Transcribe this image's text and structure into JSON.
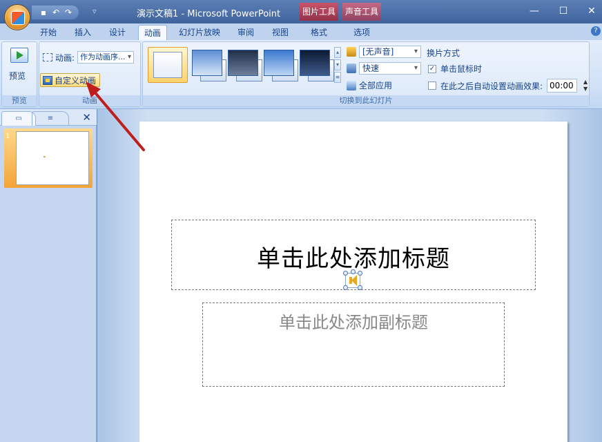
{
  "window": {
    "title": "演示文稿1 - Microsoft PowerPoint",
    "context_tabs": [
      "图片工具",
      "声音工具"
    ],
    "controls": [
      "—",
      "☐",
      "✕"
    ]
  },
  "qat": {
    "icons": [
      "save-icon",
      "undo-icon",
      "redo-icon"
    ]
  },
  "tabs": [
    "开始",
    "插入",
    "设计",
    "动画",
    "幻灯片放映",
    "审阅",
    "视图",
    "格式",
    "选项"
  ],
  "active_tab": "动画",
  "ribbon": {
    "preview": {
      "button_label": "预览",
      "group_label": "预览"
    },
    "animation": {
      "label": "动画:",
      "select_value": "作为动画序...",
      "custom_button": "自定义动画",
      "group_label": "动画"
    },
    "transition": {
      "sound_value": "[无声音]",
      "speed_value": "快速",
      "apply_all": "全部应用",
      "group_label": "切换到此幻灯片"
    },
    "advance": {
      "title": "换片方式",
      "on_click": "单击鼠标时",
      "on_click_checked": true,
      "auto_label": "在此之后自动设置动画效果:",
      "auto_checked": false,
      "auto_time": "00:00"
    }
  },
  "slide_pane": {
    "slide_number": "1"
  },
  "slide": {
    "title_placeholder": "单击此处添加标题",
    "subtitle_placeholder": "单击此处添加副标题"
  },
  "colors": {
    "annotation_arrow": "#c01d1d",
    "accent": "#15428b"
  }
}
